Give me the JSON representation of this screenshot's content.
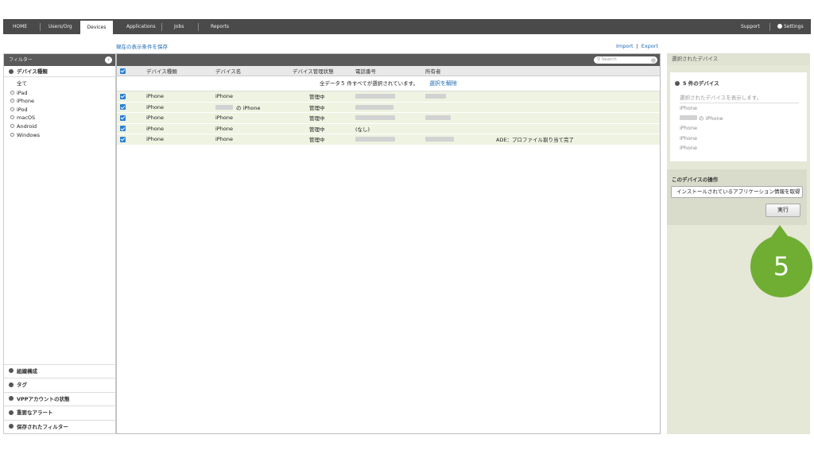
{
  "nav": {
    "items": [
      "HOME",
      "Users/Org",
      "Devices",
      "Applications",
      "Jobs",
      "Reports"
    ],
    "active": "Devices",
    "support": "Support",
    "settings": "Settings"
  },
  "links": {
    "save_view": "現在の表示条件を保存",
    "import": "Import",
    "separator": "|",
    "export": "Export"
  },
  "filter": {
    "title": "フィルター",
    "device_type_section": "デバイス種類",
    "all": "全て",
    "types": [
      "iPad",
      "iPhone",
      "iPod",
      "macOS",
      "Android",
      "Windows"
    ],
    "bottom_sections": [
      "組織構成",
      "タグ",
      "VPPアカウントの状態",
      "重要なアラート",
      "保存されたフィルター"
    ]
  },
  "table": {
    "search_placeholder": "Search",
    "headers": {
      "type": "デバイス種類",
      "name": "デバイス名",
      "status": "デバイス管理状態",
      "phone": "電話番号",
      "owner": "所有者"
    },
    "selection_info": "全データ５ 件すべてが選択されています。",
    "unselect": "選択を解除",
    "rows": [
      {
        "type": "iPhone",
        "name": "iPhone",
        "status": "管理中",
        "phone": "",
        "owner": "",
        "note": ""
      },
      {
        "type": "iPhone",
        "name": "の iPhone",
        "status": "管理中",
        "phone": "",
        "owner": "",
        "note": ""
      },
      {
        "type": "iPhone",
        "name": "iPhone",
        "status": "管理中",
        "phone": "",
        "owner": "",
        "note": ""
      },
      {
        "type": "iPhone",
        "name": "iPhone",
        "status": "管理中",
        "phone": "(なし)",
        "owner": "",
        "note": ""
      },
      {
        "type": "iPhone",
        "name": "iPhone",
        "status": "管理中",
        "phone": "",
        "owner": "",
        "note": "ADE：プロファイル割り当て完了"
      }
    ]
  },
  "selected_panel": {
    "title": "選択されたデバイス",
    "count_label": "5 件のデバイス",
    "placeholder": "選択されたデバイスを表示します。",
    "devices": [
      "iPhone",
      "の iPhone",
      "iPhone",
      "iPhone",
      "iPhone"
    ],
    "action_title": "このデバイスの操作",
    "action_selected": "インストールされているアプリケーション情報を取得",
    "run_button": "実行"
  },
  "callout": {
    "number": "5",
    "color": "#6fae33"
  },
  "colors": {
    "accent": "#2a7fd4",
    "link": "#1b6bb5",
    "nav_bg": "#4a4a4a",
    "row_bg": "#eef3e2"
  }
}
